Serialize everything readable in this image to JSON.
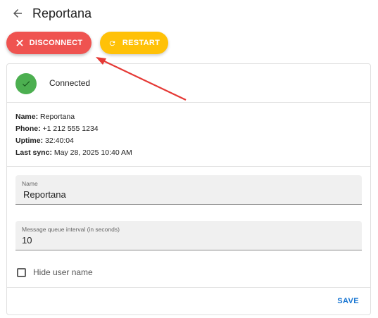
{
  "header": {
    "title": "Reportana",
    "back_icon": "arrow-left-icon"
  },
  "actions": {
    "disconnect_label": "DISCONNECT",
    "restart_label": "RESTART",
    "disconnect_color": "#ef5350",
    "restart_color": "#ffc107"
  },
  "status": {
    "text": "Connected",
    "color": "#4caf50"
  },
  "info": {
    "name_label": "Name:",
    "name_value": "Reportana",
    "phone_label": "Phone:",
    "phone_value": "+1 212 555 1234",
    "uptime_label": "Uptime:",
    "uptime_value": "32:40:04",
    "last_sync_label": "Last sync:",
    "last_sync_value": "May 28, 2025 10:40 AM"
  },
  "form": {
    "name_label": "Name",
    "name_value": "Reportana",
    "queue_label": "Message queue interval (in seconds)",
    "queue_value": "10",
    "hide_user_label": "Hide user name",
    "hide_user_checked": false,
    "save_label": "SAVE"
  },
  "colors": {
    "accent": "#1976d2",
    "annotation": "#e53935"
  }
}
